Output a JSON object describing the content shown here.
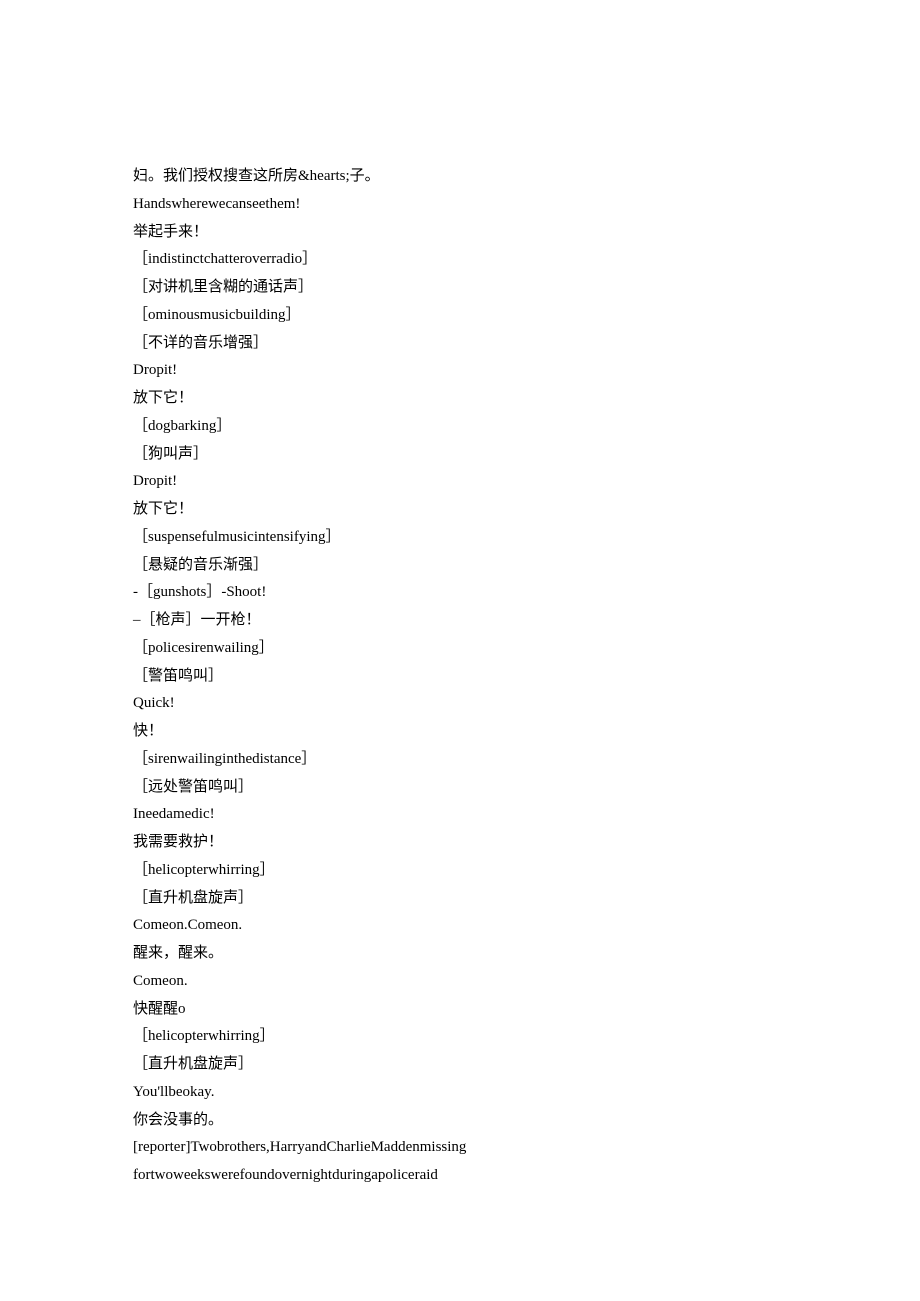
{
  "lines": [
    "妇。我们授权搜查这所房&hearts;子。",
    "Handswherewecanseethem!",
    "举起手来！",
    "［indistinctchatteroverradio］",
    "［对讲机里含糊的通话声］",
    "［ominousmusicbuilding］",
    "［不详的音乐增强］",
    "Dropit!",
    "放下它！",
    "［dogbarking］",
    "［狗叫声］",
    "Dropit!",
    "放下它！",
    "［suspensefulmusicintensifying］",
    "［悬疑的音乐渐强］",
    "-［gunshots］-Shoot!",
    "–［枪声］一开枪！",
    "［policesirenwailing］",
    "［警笛鸣叫］",
    "Quick!",
    "快！",
    "［sirenwailinginthedistance］",
    "［远处警笛鸣叫］",
    "Ineedamedic!",
    "我需要救护！",
    "［helicopterwhirring］",
    "［直升机盘旋声］",
    "Comeon.Comeon.",
    "醒来，醒来。",
    "Comeon.",
    "快醒醒o",
    "［helicopterwhirring］",
    "［直升机盘旋声］",
    "You'llbeokay.",
    "你会没事的。",
    "[reporter]Twobrothers,HarryandCharlieMaddenmissing",
    "fortwoweekswerefoundovernightduringapoliceraid"
  ]
}
